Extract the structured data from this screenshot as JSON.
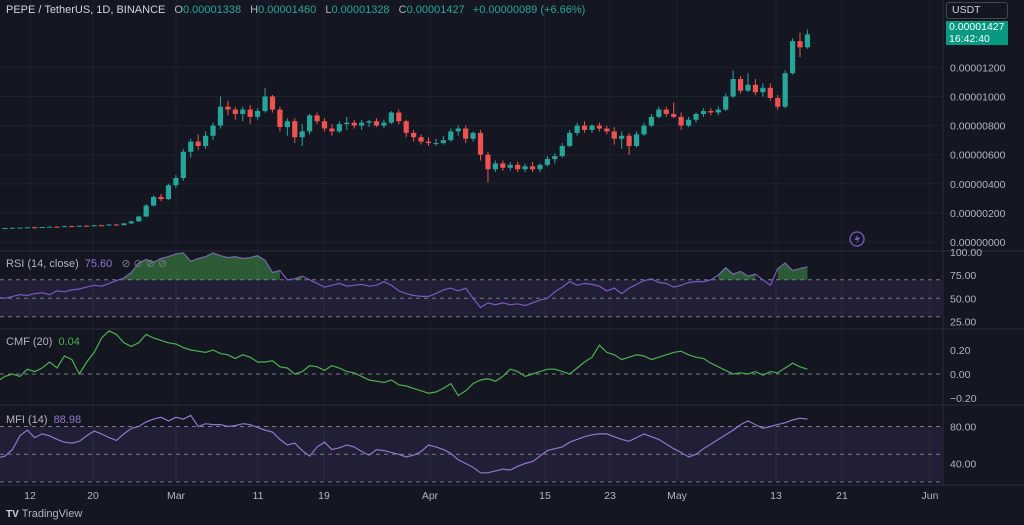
{
  "header": {
    "symbol": "PEPE / TetherUS, 1D, BINANCE",
    "o_label": "O",
    "o": "0.00001338",
    "h_label": "H",
    "h": "0.00001460",
    "l_label": "L",
    "l": "0.00001328",
    "c_label": "C",
    "c": "0.00001427",
    "change": "+0.00000089 (+6.66%)"
  },
  "currency_label": "USDT",
  "price_tag": {
    "price": "0.00001427",
    "countdown": "16:42:40"
  },
  "price_axis": [
    "0.00001200",
    "0.00001000",
    "0.00000800",
    "0.00000600",
    "0.00000400",
    "0.00000200",
    "0.00000000"
  ],
  "rsi": {
    "label": "RSI (14, close)",
    "value": "75.60",
    "ticks": [
      "100.00",
      "75.00",
      "50.00",
      "25.00"
    ]
  },
  "cmf": {
    "label": "CMF (20)",
    "value": "0.04",
    "ticks": [
      "0.20",
      "0.00",
      "−0.20"
    ]
  },
  "mfi": {
    "label": "MFI (14)",
    "value": "88.98",
    "ticks": [
      "80.00",
      "40.00"
    ]
  },
  "x_axis": [
    "12",
    "20",
    "Mar",
    "11",
    "19",
    "Apr",
    "15",
    "23",
    "May",
    "13",
    "21",
    "Jun"
  ],
  "footer": {
    "brand": "TradingView"
  },
  "colors": {
    "up": "#26a69a",
    "down": "#ef5350",
    "rsi": "#7e57c2",
    "cmf": "#4caf50",
    "mfi": "#9575cd",
    "bg": "#141722"
  },
  "chart_data": {
    "type": "candlestick",
    "price_scale": [
      0,
      1.45e-05
    ],
    "candles": [
      [
        9.5e-07,
        9.7e-07,
        9.3e-07,
        9.6e-07
      ],
      [
        9.6e-07,
        9.9e-07,
        9.4e-07,
        9.8e-07
      ],
      [
        9.8e-07,
        1e-06,
        9.6e-07,
        9.9e-07
      ],
      [
        9.9e-07,
        1.02e-06,
        9.7e-07,
        1.01e-06
      ],
      [
        1.01e-06,
        1.05e-06,
        9.8e-07,
        1e-06
      ],
      [
        1e-06,
        1.04e-06,
        9.8e-07,
        1.03e-06
      ],
      [
        1.03e-06,
        1.07e-06,
        1.01e-06,
        1.05e-06
      ],
      [
        1.05e-06,
        1.08e-06,
        1.01e-06,
        1.03e-06
      ],
      [
        1.03e-06,
        1.1e-06,
        1.02e-06,
        1.09e-06
      ],
      [
        1.09e-06,
        1.12e-06,
        1.05e-06,
        1.07e-06
      ],
      [
        1.07e-06,
        1.13e-06,
        1.06e-06,
        1.12e-06
      ],
      [
        1.12e-06,
        1.15e-06,
        1.07e-06,
        1.09e-06
      ],
      [
        1.09e-06,
        1.16e-06,
        1.08e-06,
        1.15e-06
      ],
      [
        1.15e-06,
        1.18e-06,
        1.1e-06,
        1.13e-06
      ],
      [
        1.13e-06,
        1.22e-06,
        1.12e-06,
        1.2e-06
      ],
      [
        1.2e-06,
        1.25e-06,
        1.14e-06,
        1.16e-06
      ],
      [
        1.16e-06,
        1.3e-06,
        1.15e-06,
        1.28e-06
      ],
      [
        1.28e-06,
        1.45e-06,
        1.25e-06,
        1.42e-06
      ],
      [
        1.42e-06,
        1.8e-06,
        1.4e-06,
        1.75e-06
      ],
      [
        1.75e-06,
        2.6e-06,
        1.72e-06,
        2.5e-06
      ],
      [
        2.5e-06,
        3.2e-06,
        2.45e-06,
        3.1e-06
      ],
      [
        3.1e-06,
        3.3e-06,
        2.8e-06,
        2.95e-06
      ],
      [
        2.95e-06,
        4e-06,
        2.9e-06,
        3.9e-06
      ],
      [
        3.9e-06,
        4.6e-06,
        3.7e-06,
        4.4e-06
      ],
      [
        4.4e-06,
        6.4e-06,
        4.2e-06,
        6.2e-06
      ],
      [
        6.2e-06,
        7.1e-06,
        5.8e-06,
        6.9e-06
      ],
      [
        6.9e-06,
        7.4e-06,
        6.3e-06,
        6.6e-06
      ],
      [
        6.6e-06,
        7.6e-06,
        6.4e-06,
        7.3e-06
      ],
      [
        7.3e-06,
        8.2e-06,
        7e-06,
        8e-06
      ],
      [
        8e-06,
        1e-05,
        7.8e-06,
        9.3e-06
      ],
      [
        9.3e-06,
        9.7e-06,
        8.7e-06,
        9.1e-06
      ],
      [
        9.1e-06,
        9.3e-06,
        8.4e-06,
        8.8e-06
      ],
      [
        8.8e-06,
        9.3e-06,
        8.3e-06,
        9.1e-06
      ],
      [
        9.1e-06,
        9.4e-06,
        8.1e-06,
        8.6e-06
      ],
      [
        8.6e-06,
        9.2e-06,
        8.4e-06,
        9e-06
      ],
      [
        9e-06,
        1.06e-05,
        8.9e-06,
        1e-05
      ],
      [
        1e-05,
        1.01e-05,
        8.9e-06,
        9.1e-06
      ],
      [
        9.1e-06,
        9.3e-06,
        7.6e-06,
        7.9e-06
      ],
      [
        7.9e-06,
        8.5e-06,
        7.3e-06,
        8.3e-06
      ],
      [
        8.3e-06,
        8.5e-06,
        6.8e-06,
        7.2e-06
      ],
      [
        7.2e-06,
        8.1e-06,
        6.6e-06,
        7.6e-06
      ],
      [
        7.6e-06,
        8.8e-06,
        7.4e-06,
        8.7e-06
      ],
      [
        8.7e-06,
        8.9e-06,
        8.1e-06,
        8.3e-06
      ],
      [
        8.3e-06,
        8.5e-06,
        7.6e-06,
        7.8e-06
      ],
      [
        7.8e-06,
        8.1e-06,
        7.3e-06,
        7.6e-06
      ],
      [
        7.6e-06,
        8.3e-06,
        7.5e-06,
        8.1e-06
      ],
      [
        8.1e-06,
        8.6e-06,
        7.7e-06,
        8.2e-06
      ],
      [
        8.2e-06,
        8.4e-06,
        7.8e-06,
        8e-06
      ],
      [
        8e-06,
        8.4e-06,
        7.7e-06,
        8.2e-06
      ],
      [
        8.2e-06,
        8.4e-06,
        7.9e-06,
        8.3e-06
      ],
      [
        8.3e-06,
        8.5e-06,
        7.9e-06,
        8e-06
      ],
      [
        8e-06,
        8.4e-06,
        7.8e-06,
        8.2e-06
      ],
      [
        8.2e-06,
        9e-06,
        8.1e-06,
        8.9e-06
      ],
      [
        8.9e-06,
        9.1e-06,
        8.1e-06,
        8.3e-06
      ],
      [
        8.3e-06,
        8.4e-06,
        7.2e-06,
        7.5e-06
      ],
      [
        7.5e-06,
        7.7e-06,
        6.9e-06,
        7.2e-06
      ],
      [
        7.2e-06,
        7.4e-06,
        6.7e-06,
        6.9e-06
      ],
      [
        6.9e-06,
        7.2e-06,
        6.6e-06,
        6.8e-06
      ],
      [
        6.8e-06,
        7.1e-06,
        6.6e-06,
        6.8e-06
      ],
      [
        6.8e-06,
        7.3e-06,
        6.7e-06,
        7e-06
      ],
      [
        7e-06,
        7.8e-06,
        6.9e-06,
        7.6e-06
      ],
      [
        7.6e-06,
        8e-06,
        7.3e-06,
        7.8e-06
      ],
      [
        7.8e-06,
        8e-06,
        6.8e-06,
        7.1e-06
      ],
      [
        7.1e-06,
        7.6e-06,
        6.9e-06,
        7.5e-06
      ],
      [
        7.5e-06,
        7.7e-06,
        5.6e-06,
        6e-06
      ],
      [
        6e-06,
        6.2e-06,
        4.1e-06,
        5e-06
      ],
      [
        5e-06,
        5.6e-06,
        4.8e-06,
        5.4e-06
      ],
      [
        5.4e-06,
        5.6e-06,
        4.9e-06,
        5.1e-06
      ],
      [
        5.1e-06,
        5.5e-06,
        4.9e-06,
        5.3e-06
      ],
      [
        5.3e-06,
        5.5e-06,
        4.8e-06,
        5e-06
      ],
      [
        5e-06,
        5.4e-06,
        4.8e-06,
        5.2e-06
      ],
      [
        5.2e-06,
        5.5e-06,
        4.8e-06,
        5e-06
      ],
      [
        5e-06,
        5.4e-06,
        4.8e-06,
        5.3e-06
      ],
      [
        5.3e-06,
        5.9e-06,
        5.2e-06,
        5.7e-06
      ],
      [
        5.7e-06,
        6.1e-06,
        5.4e-06,
        5.9e-06
      ],
      [
        5.9e-06,
        6.8e-06,
        5.8e-06,
        6.6e-06
      ],
      [
        6.6e-06,
        7.7e-06,
        6.5e-06,
        7.5e-06
      ],
      [
        7.5e-06,
        8.2e-06,
        7.3e-06,
        8e-06
      ],
      [
        8e-06,
        8.3e-06,
        7.5e-06,
        7.7e-06
      ],
      [
        7.7e-06,
        8.1e-06,
        7.5e-06,
        8e-06
      ],
      [
        8e-06,
        8.2e-06,
        7.6e-06,
        7.8e-06
      ],
      [
        7.8e-06,
        8e-06,
        7.4e-06,
        7.6e-06
      ],
      [
        7.6e-06,
        7.9e-06,
        6.7e-06,
        7.1e-06
      ],
      [
        7.1e-06,
        7.6e-06,
        6.4e-06,
        7.3e-06
      ],
      [
        7.3e-06,
        7.5e-06,
        6e-06,
        6.6e-06
      ],
      [
        6.6e-06,
        7.6e-06,
        6.5e-06,
        7.4e-06
      ],
      [
        7.4e-06,
        8.2e-06,
        7.3e-06,
        8e-06
      ],
      [
        8e-06,
        8.8e-06,
        7.9e-06,
        8.6e-06
      ],
      [
        8.6e-06,
        9.3e-06,
        8.5e-06,
        9.1e-06
      ],
      [
        9.1e-06,
        9.3e-06,
        8.6e-06,
        8.8e-06
      ],
      [
        8.8e-06,
        9.6e-06,
        8.5e-06,
        8.6e-06
      ],
      [
        8.6e-06,
        8.9e-06,
        7.7e-06,
        8e-06
      ],
      [
        8e-06,
        8.6e-06,
        7.9e-06,
        8.4e-06
      ],
      [
        8.4e-06,
        8.9e-06,
        8.2e-06,
        8.8e-06
      ],
      [
        8.8e-06,
        9.2e-06,
        8.6e-06,
        9e-06
      ],
      [
        9e-06,
        9.2e-06,
        8.7e-06,
        8.9e-06
      ],
      [
        8.9e-06,
        9.3e-06,
        8.7e-06,
        9.1e-06
      ],
      [
        9.1e-06,
        1.02e-05,
        9e-06,
        1e-05
      ],
      [
        1e-05,
        1.18e-05,
        9.9e-06,
        1.12e-05
      ],
      [
        1.12e-05,
        1.14e-05,
        1.02e-05,
        1.04e-05
      ],
      [
        1.04e-05,
        1.16e-05,
        1.03e-05,
        1.08e-05
      ],
      [
        1.08e-05,
        1.12e-05,
        1.01e-05,
        1.03e-05
      ],
      [
        1.03e-05,
        1.09e-05,
        1e-05,
        1.06e-05
      ],
      [
        1.06e-05,
        1.09e-05,
        9.7e-06,
        9.9e-06
      ],
      [
        9.9e-06,
        1.01e-05,
        9.1e-06,
        9.3e-06
      ],
      [
        9.3e-06,
        1.18e-05,
        9.2e-06,
        1.16e-05
      ],
      [
        1.16e-05,
        1.4e-05,
        1.15e-05,
        1.38e-05
      ],
      [
        1.38e-05,
        1.44e-05,
        1.27e-05,
        1.338e-05
      ],
      [
        1.338e-05,
        1.46e-05,
        1.328e-05,
        1.427e-05
      ]
    ],
    "rsi": [
      51,
      50,
      52,
      54,
      53,
      55,
      56,
      54,
      58,
      57,
      59,
      60,
      62,
      64,
      63,
      66,
      69,
      72,
      78,
      88,
      92,
      89,
      93,
      95,
      98,
      99,
      90,
      93,
      95,
      99,
      96,
      94,
      95,
      93,
      94,
      96,
      91,
      78,
      80,
      70,
      71,
      74,
      70,
      66,
      62,
      64,
      66,
      63,
      64,
      65,
      63,
      64,
      68,
      64,
      58,
      55,
      53,
      52,
      52,
      55,
      59,
      61,
      58,
      61,
      50,
      40,
      45,
      43,
      45,
      43,
      44,
      42,
      45,
      48,
      50,
      57,
      62,
      68,
      64,
      66,
      65,
      63,
      58,
      61,
      55,
      61,
      65,
      69,
      71,
      67,
      66,
      62,
      64,
      67,
      68,
      68,
      70,
      75,
      83,
      76,
      79,
      74,
      76,
      70,
      64,
      82,
      88,
      80,
      82,
      84
    ],
    "cmf": [
      -0.12,
      -0.13,
      -0.12,
      -0.1,
      -0.08,
      -0.04,
      -0.06,
      -0.02,
      0.0,
      -0.02,
      0.04,
      0.02,
      0.05,
      0.1,
      0.05,
      0.15,
      0.12,
      0.0,
      0.1,
      0.18,
      0.3,
      0.36,
      0.33,
      0.26,
      0.23,
      0.26,
      0.33,
      0.3,
      0.28,
      0.26,
      0.25,
      0.22,
      0.2,
      0.19,
      0.18,
      0.2,
      0.17,
      0.16,
      0.13,
      0.16,
      0.14,
      0.1,
      0.1,
      0.11,
      0.06,
      0.05,
      0.0,
      0.02,
      0.07,
      0.06,
      0.03,
      0.07,
      0.05,
      0.02,
      0.01,
      -0.02,
      -0.05,
      -0.06,
      -0.07,
      -0.05,
      -0.09,
      -0.1,
      -0.12,
      -0.14,
      -0.16,
      -0.15,
      -0.12,
      -0.08,
      -0.18,
      -0.14,
      -0.08,
      -0.05,
      -0.04,
      -0.06,
      -0.02,
      0.04,
      0.02,
      -0.02,
      0.0,
      0.02,
      0.04,
      0.04,
      0.02,
      0.0,
      0.05,
      0.1,
      0.14,
      0.24,
      0.18,
      0.16,
      0.12,
      0.14,
      0.16,
      0.15,
      0.12,
      0.14,
      0.16,
      0.18,
      0.19,
      0.16,
      0.14,
      0.13,
      0.09,
      0.06,
      0.03,
      0.0,
      0.01,
      0.0,
      0.02,
      -0.01,
      0.02,
      0.01,
      0.05,
      0.09,
      0.06,
      0.04
    ],
    "mfi": [
      45,
      44,
      46,
      48,
      55,
      70,
      76,
      68,
      72,
      70,
      66,
      63,
      62,
      64,
      70,
      75,
      72,
      68,
      65,
      72,
      78,
      80,
      85,
      88,
      90,
      86,
      90,
      88,
      92,
      80,
      83,
      82,
      82,
      80,
      81,
      83,
      82,
      79,
      76,
      74,
      66,
      60,
      62,
      54,
      48,
      58,
      63,
      55,
      57,
      60,
      58,
      53,
      49,
      55,
      54,
      52,
      50,
      47,
      49,
      53,
      60,
      58,
      55,
      51,
      44,
      40,
      36,
      30,
      30,
      32,
      34,
      33,
      37,
      40,
      42,
      48,
      54,
      56,
      58,
      63,
      66,
      69,
      71,
      72,
      72,
      69,
      66,
      64,
      68,
      72,
      69,
      66,
      61,
      56,
      52,
      47,
      50,
      56,
      61,
      66,
      71,
      76,
      82,
      86,
      82,
      78,
      80,
      82,
      84,
      87,
      89,
      88
    ],
    "rsi_scale": [
      20,
      100
    ],
    "cmf_scale": [
      -0.25,
      0.35
    ],
    "mfi_scale": [
      20,
      100
    ],
    "x_ticks": [
      "12",
      "20",
      "Mar",
      "11",
      "19",
      "Apr",
      "15",
      "23",
      "May",
      "13",
      "21",
      "Jun"
    ]
  }
}
